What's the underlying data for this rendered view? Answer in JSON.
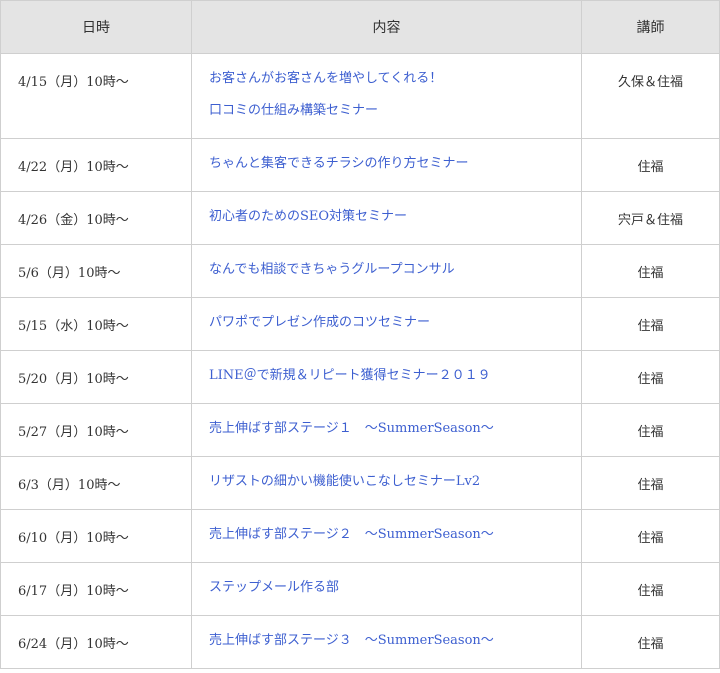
{
  "headers": {
    "date": "日時",
    "content": "内容",
    "lecturer": "講師"
  },
  "rows": [
    {
      "date": "4/15（月）10時〜",
      "content": [
        "お客さんがお客さんを増やしてくれる！",
        "口コミの仕組み構築セミナー"
      ],
      "lecturer": "久保＆住福"
    },
    {
      "date": "4/22（月）10時〜",
      "content": [
        "ちゃんと集客できるチラシの作り方セミナー"
      ],
      "lecturer": "住福"
    },
    {
      "date": "4/26（金）10時〜",
      "content": [
        "初心者のためのSEO対策セミナー"
      ],
      "lecturer": "宍戸＆住福"
    },
    {
      "date": "5/6（月）10時〜",
      "content": [
        "なんでも相談できちゃうグループコンサル"
      ],
      "lecturer": "住福"
    },
    {
      "date": "5/15（水）10時〜",
      "content": [
        "パワポでプレゼン作成のコツセミナー"
      ],
      "lecturer": "住福"
    },
    {
      "date": "5/20（月）10時〜",
      "content": [
        "LINE＠で新規＆リピート獲得セミナー２０１９"
      ],
      "lecturer": "住福"
    },
    {
      "date": "5/27（月）10時〜",
      "content": [
        "売上伸ばす部ステージ１　〜SummerSeason〜"
      ],
      "lecturer": "住福"
    },
    {
      "date": "6/3（月）10時〜",
      "content": [
        "リザストの細かい機能使いこなしセミナーLv2"
      ],
      "lecturer": "住福"
    },
    {
      "date": "6/10（月）10時〜",
      "content": [
        "売上伸ばす部ステージ２　〜SummerSeason〜"
      ],
      "lecturer": "住福"
    },
    {
      "date": "6/17（月）10時〜",
      "content": [
        "ステップメール作る部"
      ],
      "lecturer": "住福"
    },
    {
      "date": "6/24（月）10時〜",
      "content": [
        "売上伸ばす部ステージ３　〜SummerSeason〜"
      ],
      "lecturer": "住福"
    }
  ],
  "colors": {
    "header_bg": "#e4e4e4",
    "border": "#cfcfcf",
    "link": "#3d5fd0",
    "text": "#333333"
  }
}
